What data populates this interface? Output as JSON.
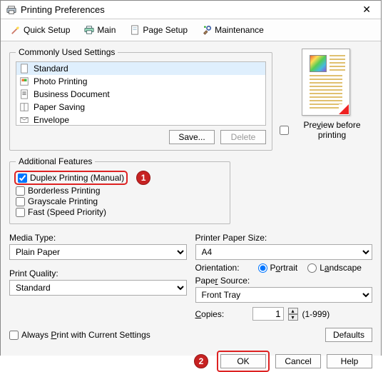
{
  "window": {
    "title": "Printing Preferences"
  },
  "tabs": {
    "quick": "Quick Setup",
    "main": "Main",
    "page": "Page Setup",
    "maint": "Maintenance"
  },
  "settings": {
    "legend": "Commonly Used Settings",
    "items": [
      "Standard",
      "Photo Printing",
      "Business Document",
      "Paper Saving",
      "Envelope"
    ],
    "save": "Save...",
    "delete": "Delete"
  },
  "preview": {
    "checkbox": "Preview before printing"
  },
  "features": {
    "legend": "Additional Features",
    "duplex": "Duplex Printing (Manual)",
    "borderless": "Borderless Printing",
    "grayscale": "Grayscale Printing",
    "fast": "Fast (Speed Priority)"
  },
  "annotations": {
    "one": "1",
    "two": "2"
  },
  "left": {
    "media_label": "Media Type:",
    "media_value": "Plain Paper",
    "quality_label": "Print Quality:",
    "quality_value": "Standard"
  },
  "right": {
    "size_label": "Printer Paper Size:",
    "size_value": "A4",
    "orient_label": "Orientation:",
    "portrait": "Portrait",
    "landscape": "Landscape",
    "source_label": "Paper Source:",
    "source_value": "Front Tray",
    "copies_label": "Copies:",
    "copies_value": "1",
    "copies_range": "(1-999)"
  },
  "bottom": {
    "always": "Always Print with Current Settings",
    "defaults": "Defaults",
    "ok": "OK",
    "cancel": "Cancel",
    "help": "Help"
  }
}
